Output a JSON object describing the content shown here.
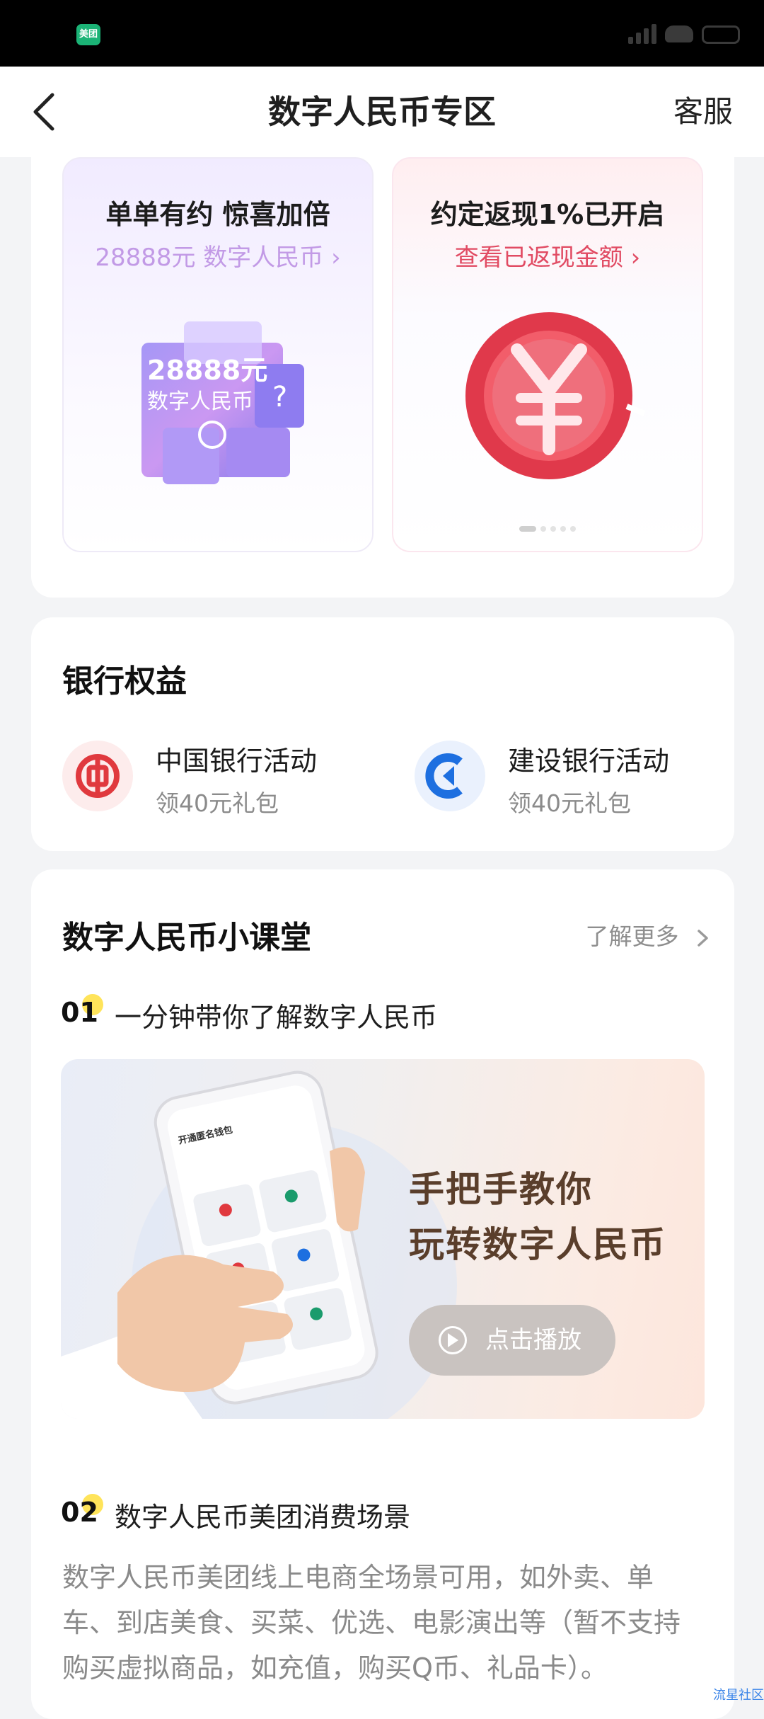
{
  "status_bar": {
    "app_badge": "美团"
  },
  "header": {
    "title": "数字人民币专区",
    "service": "客服"
  },
  "promos": [
    {
      "title": "单单有约 惊喜加倍",
      "subtitle": "28888元 数字人民币 ›",
      "img_line1": "28888元",
      "img_line2": "数字人民币"
    },
    {
      "title": "约定返现1%已开启",
      "subtitle": "查看已返现金额 ›"
    }
  ],
  "bank": {
    "title": "银行权益",
    "items": [
      {
        "name": "中国银行活动",
        "sub": "领40元礼包"
      },
      {
        "name": "建设银行活动",
        "sub": "领40元礼包"
      }
    ]
  },
  "classroom": {
    "title": "数字人民币小课堂",
    "more": "了解更多",
    "steps": [
      {
        "num": "01",
        "title": "一分钟带你了解数字人民币"
      },
      {
        "num": "02",
        "title": "数字人民币美团消费场景"
      }
    ],
    "video": {
      "line1": "手把手教你",
      "line2": "玩转数字人民币",
      "play_label": "点击播放",
      "phone_heading": "开通匿名钱包"
    },
    "description": "数字人民币美团线上电商全场景可用，如外卖、单车、到店美食、买菜、优选、电影演出等（暂不支持购买虚拟商品，如充值，购买Q币、礼品卡）。"
  },
  "watermark": "流星社区",
  "colors": {
    "brand_green": "#1bb376",
    "boc_red": "#e0393e",
    "ccb_blue": "#1d6fe0",
    "promo_pink": "#e14b63",
    "promo_purple": "#c29ae6"
  }
}
